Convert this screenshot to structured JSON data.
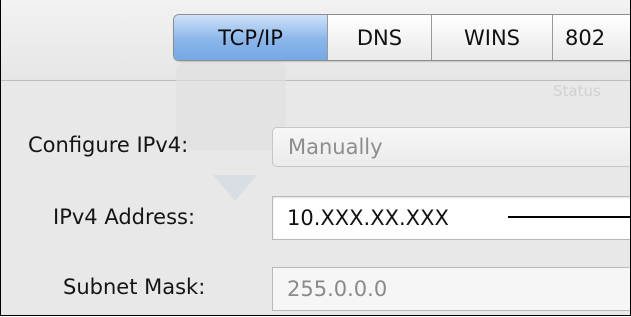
{
  "tabs": [
    {
      "label": "TCP/IP",
      "selected": true
    },
    {
      "label": "DNS",
      "selected": false
    },
    {
      "label": "WINS",
      "selected": false
    },
    {
      "label": "802",
      "selected": false
    }
  ],
  "background_text": {
    "status": "Status"
  },
  "form": {
    "configure_label": "Configure IPv4:",
    "configure_value": "Manually",
    "ipv4_label": "IPv4 Address:",
    "ipv4_value": "10.XXX.XX.XXX",
    "subnet_label": "Subnet Mask:",
    "subnet_value": "255.0.0.0"
  },
  "colors": {
    "selected_tab": "#8ab6ea",
    "callout": "#000000"
  }
}
